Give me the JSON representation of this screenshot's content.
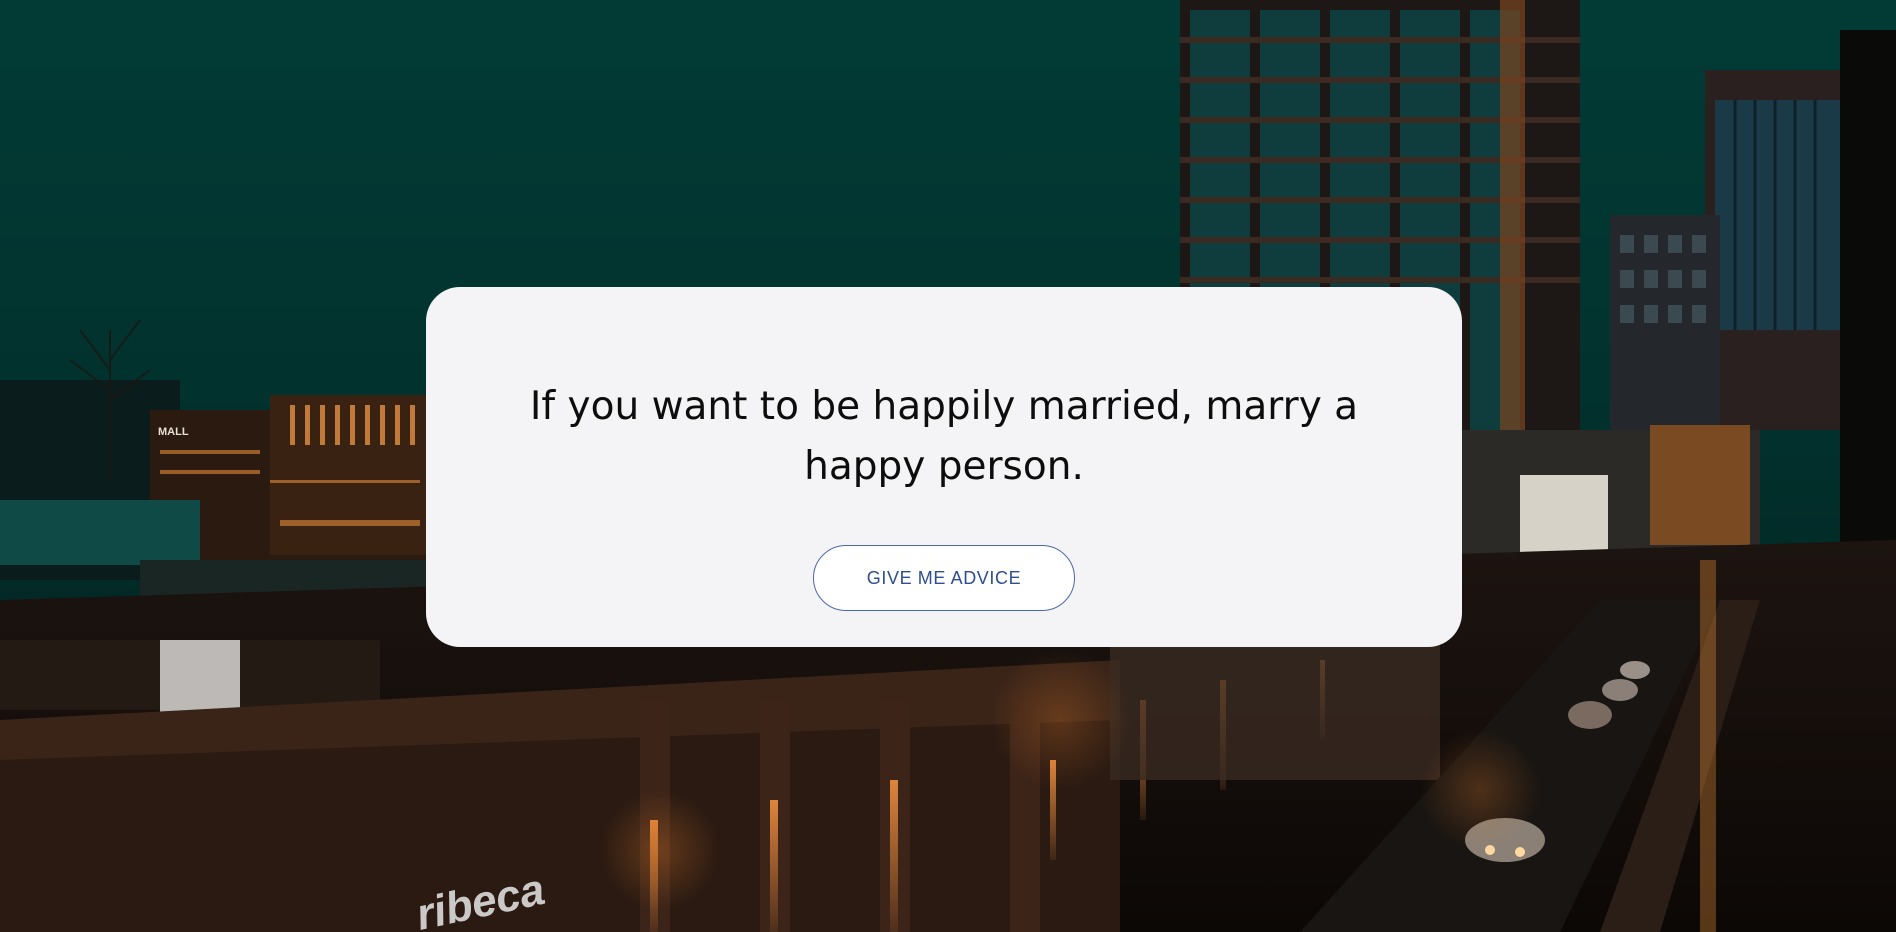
{
  "background": {
    "description_icon": "night-city-street-photo",
    "sign_text": "ribeca",
    "mall_text": "MALL"
  },
  "card": {
    "quote": "If you want to be happily married, marry a happy person.",
    "button_label": "GIVE ME ADVICE"
  },
  "colors": {
    "sky": "#033a35",
    "card_bg": "#f4f4f6",
    "button_border": "#4a68a6",
    "button_text": "#2e4f8f",
    "street_light": "#c8641a"
  }
}
